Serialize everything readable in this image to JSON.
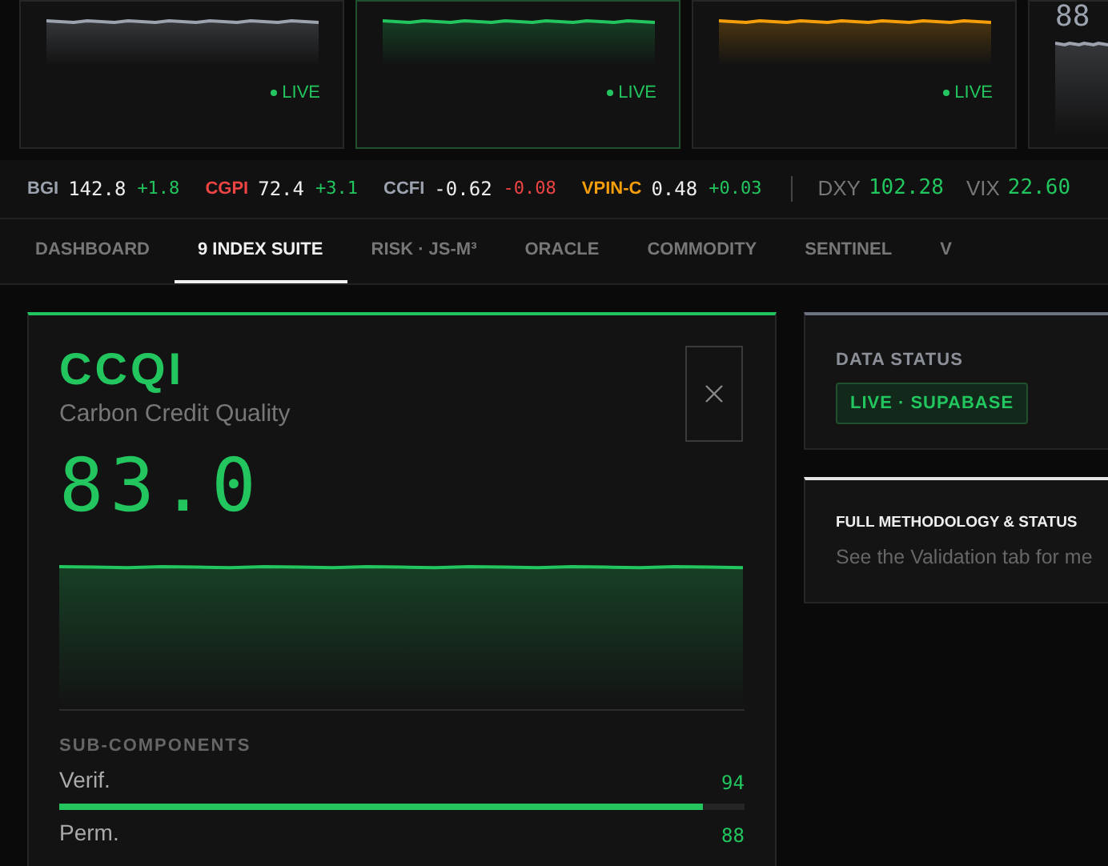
{
  "index_cards": [
    {
      "color": "#9ca3af",
      "live": "LIVE",
      "selected": false
    },
    {
      "color": "#22c55e",
      "live": "LIVE",
      "selected": true
    },
    {
      "color": "#f59e0b",
      "live": "LIVE",
      "selected": false
    },
    {
      "value": "88",
      "color": "#9ca3af",
      "selected": false
    }
  ],
  "ticker": [
    {
      "kind": "index",
      "symbol": "BGI",
      "color": "#9ca3af",
      "value": "142.8",
      "change": "+1.8",
      "negative": false
    },
    {
      "kind": "index",
      "symbol": "CGPI",
      "color": "#ef4444",
      "value": "72.4",
      "change": "+3.1",
      "negative": false
    },
    {
      "kind": "index",
      "symbol": "CCFI",
      "color": "#9ca3af",
      "value": "-0.62",
      "change": "-0.08",
      "negative": true
    },
    {
      "kind": "index",
      "symbol": "VPIN-C",
      "color": "#f59e0b",
      "value": "0.48",
      "change": "+0.03",
      "negative": false
    },
    {
      "kind": "market",
      "symbol": "DXY",
      "value": "102.28"
    },
    {
      "kind": "market",
      "symbol": "VIX",
      "value": "22.60"
    }
  ],
  "tabs": [
    {
      "label": "DASHBOARD",
      "selected": false
    },
    {
      "label": "9 INDEX SUITE",
      "selected": true
    },
    {
      "label": "RISK · JS-M³",
      "selected": false
    },
    {
      "label": "ORACLE",
      "selected": false
    },
    {
      "label": "COMMODITY",
      "selected": false
    },
    {
      "label": "SENTINEL",
      "selected": false
    },
    {
      "label": "V",
      "selected": false
    }
  ],
  "detail": {
    "code": "CCQI",
    "name": "Carbon Credit Quality",
    "value": "83.0",
    "section": "SUB-COMPONENTS",
    "components": [
      {
        "label": "Verif.",
        "value": "94",
        "level": 0.94
      },
      {
        "label": "Perm.",
        "value": "88"
      }
    ]
  },
  "status_panel": {
    "title": "DATA STATUS",
    "badge": "LIVE · SUPABASE"
  },
  "methodology_panel": {
    "title": "FULL METHODOLOGY & STATUS",
    "text": "See the Validation tab for me"
  }
}
